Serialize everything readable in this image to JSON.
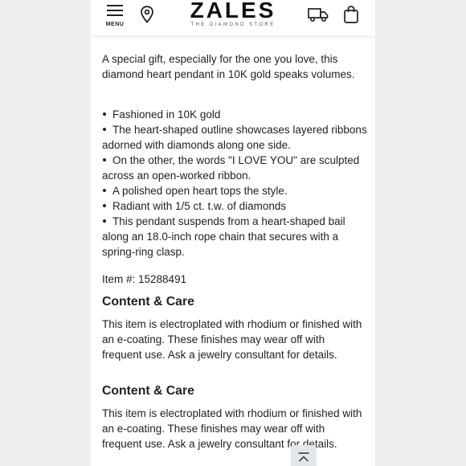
{
  "header": {
    "menu_label": "MENU",
    "logo_main": "ZALES",
    "logo_sub": "THE DIAMOND STORE"
  },
  "product": {
    "intro": "A special gift, especially for the one you love, this diamond heart pendant in 10K gold speaks volumes.",
    "bullets": [
      "Fashioned in 10K gold",
      "The heart-shaped outline showcases layered ribbons adorned with diamonds along one side.",
      "On the other, the words \"I LOVE YOU\" are sculpted across an open-worked ribbon.",
      "A polished open heart tops the style.",
      "Radiant with 1/5 ct. t.w. of diamonds",
      "This pendant suspends from a heart-shaped bail along an 18.0-inch rope chain that secures with a spring-ring clasp."
    ],
    "item_number": "Item #: 15288491",
    "sections": [
      {
        "title": "Content & Care",
        "body": "This item is electroplated with rhodium or finished with an e-coating. These finishes may wear off with frequent use. Ask a jewelry consultant for details."
      },
      {
        "title": "Content & Care",
        "body": "This item is electroplated with rhodium or finished with an e-coating. These finishes may wear off with frequent use. Ask a jewelry consultant for details."
      }
    ]
  },
  "icons": {
    "menu": "hamburger-icon",
    "store_locator": "location-pin-icon",
    "shipping": "delivery-truck-icon",
    "bag": "shopping-bag-icon",
    "scroll_top": "chevron-up-icon"
  }
}
